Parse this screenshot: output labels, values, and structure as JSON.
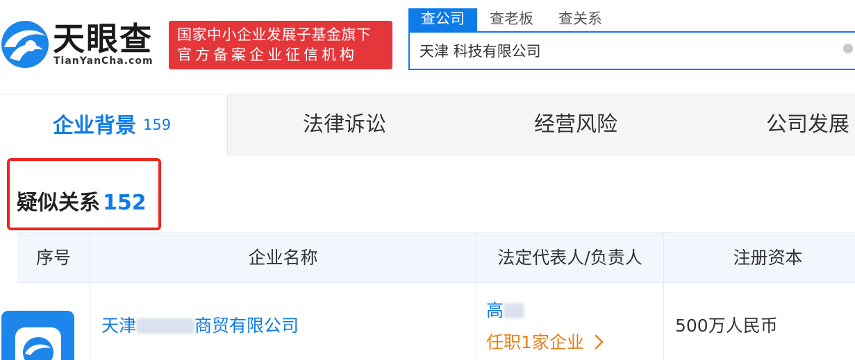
{
  "brand": {
    "name": "天眼查",
    "domain": "TianYanCha.com",
    "banner_line1": "国家中小企业发展子基金旗下",
    "banner_line2": "官方备案企业征信机构"
  },
  "search": {
    "tabs": [
      "查公司",
      "查老板",
      "查关系"
    ],
    "active_tab": 0,
    "value": "天津 科技有限公司"
  },
  "nav": {
    "tabs": [
      {
        "label": "企业背景",
        "count": "159"
      },
      {
        "label": "法律诉讼"
      },
      {
        "label": "经营风险"
      },
      {
        "label": "公司发展"
      }
    ],
    "active_tab": 0
  },
  "section": {
    "title": "疑似关系",
    "count": "152"
  },
  "table": {
    "headers": [
      "序号",
      "企业名称",
      "法定代表人/负责人",
      "注册资本"
    ],
    "rows": [
      {
        "company_prefix": "天津",
        "company_suffix": "商贸有限公司",
        "person": "高",
        "position_link": "任职1家企业",
        "capital": "500万人民币"
      }
    ]
  },
  "colors": {
    "accent": "#0d7be8",
    "highlight_box": "#f0231e",
    "link_orange": "#e8801a",
    "banner_red": "#e5363a"
  }
}
